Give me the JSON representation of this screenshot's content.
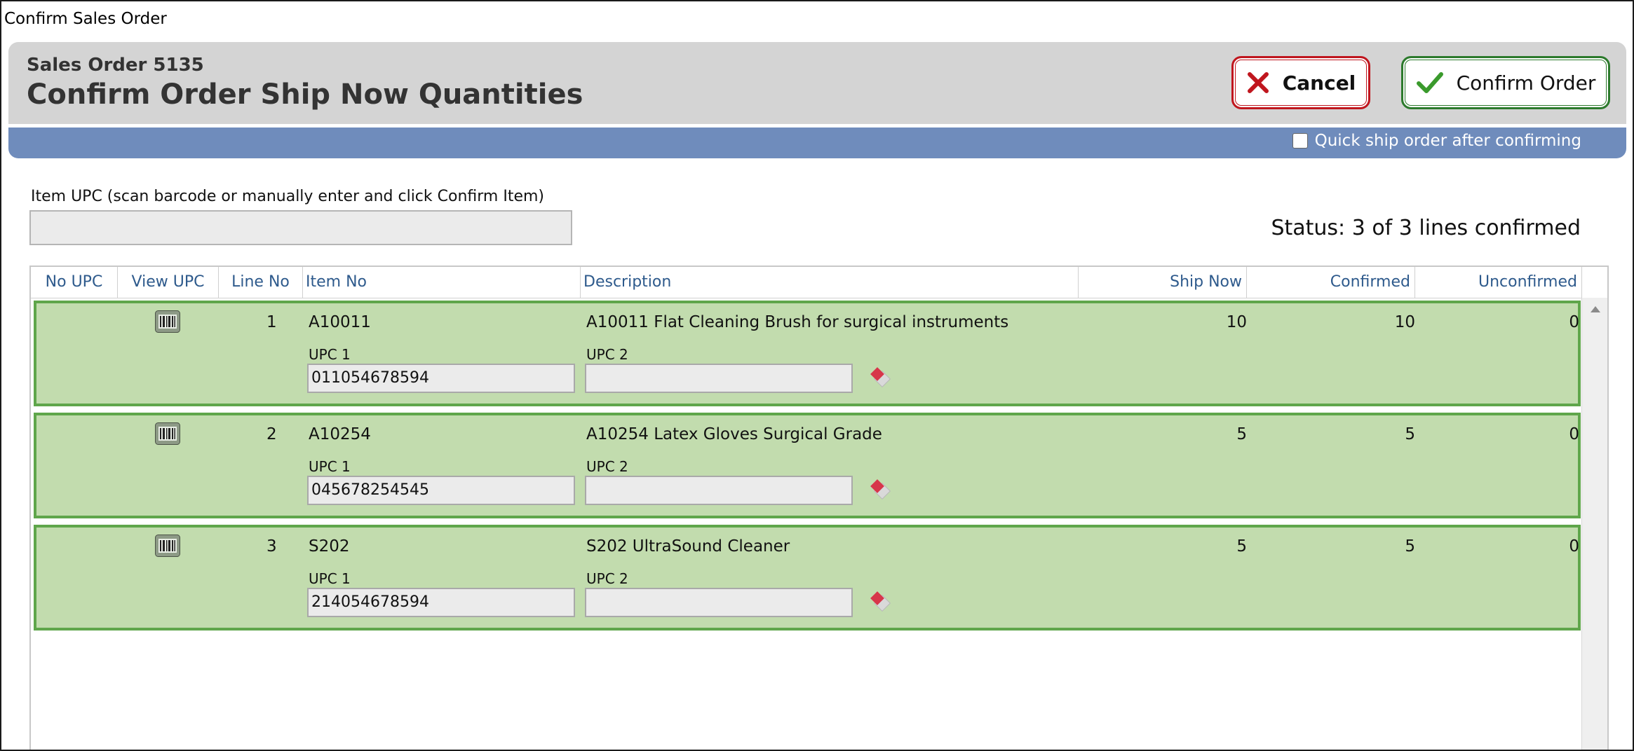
{
  "window": {
    "title": "Confirm Sales Order"
  },
  "header": {
    "subtitle": "Sales Order 5135",
    "title": "Confirm Order Ship Now Quantities",
    "cancel_label": "Cancel",
    "confirm_label": "Confirm Order"
  },
  "options": {
    "quick_ship_label": "Quick ship order after confirming",
    "quick_ship_checked": false
  },
  "upc_entry": {
    "label": "Item UPC (scan barcode or manually enter and click Confirm Item)",
    "value": ""
  },
  "status": {
    "text": "Status: 3 of 3 lines confirmed"
  },
  "grid": {
    "columns": {
      "no_upc": "No UPC",
      "view_upc": "View UPC",
      "line_no": "Line No",
      "item_no": "Item No",
      "description": "Description",
      "ship_now": "Ship Now",
      "confirmed": "Confirmed",
      "unconfirmed": "Unconfirmed"
    },
    "upc1_label": "UPC 1",
    "upc2_label": "UPC 2",
    "rows": [
      {
        "line_no": "1",
        "item_no": "A10011",
        "description": "A10011 Flat Cleaning Brush for surgical instruments",
        "ship_now": "10",
        "confirmed": "10",
        "unconfirmed": "0",
        "upc1": "011054678594",
        "upc2": ""
      },
      {
        "line_no": "2",
        "item_no": "A10254",
        "description": "A10254 Latex Gloves Surgical Grade",
        "ship_now": "5",
        "confirmed": "5",
        "unconfirmed": "0",
        "upc1": "045678254545",
        "upc2": ""
      },
      {
        "line_no": "3",
        "item_no": "S202",
        "description": "S202 UltraSound Cleaner",
        "ship_now": "5",
        "confirmed": "5",
        "unconfirmed": "0",
        "upc1": "214054678594",
        "upc2": ""
      }
    ]
  },
  "colors": {
    "header_bg": "#d4d4d4",
    "accent_bar": "#6f8cbc",
    "cancel_border": "#c0161e",
    "confirm_border": "#2c7a2c",
    "row_bg": "#c2dcae",
    "row_border": "#5fa64b",
    "column_header_text": "#2e5a8c"
  },
  "icons": {
    "cancel": "x-icon",
    "confirm": "checkmark-icon",
    "view_upc": "barcode-icon",
    "clear_upc": "eraser-icon"
  }
}
